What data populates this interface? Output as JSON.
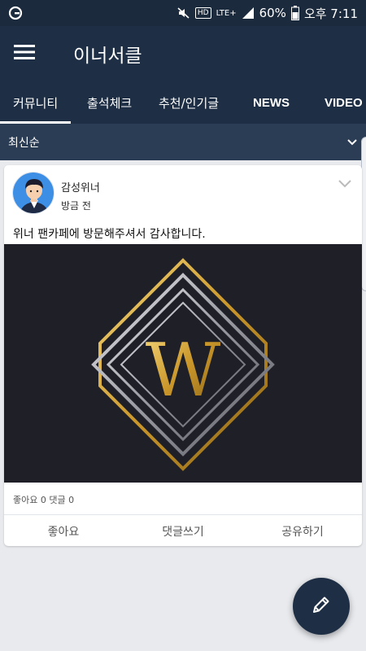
{
  "status_bar": {
    "battery": "60%",
    "time": "오후 7:11",
    "hd_badge": "HD",
    "lte_badge": "LTE+",
    "icons": [
      "carrier-logo-icon",
      "mute-icon",
      "hd-icon",
      "lte-icon",
      "signal-icon",
      "battery-icon"
    ]
  },
  "app_bar": {
    "title": "이너서클",
    "menu_icon": "hamburger-menu-icon"
  },
  "tabs": [
    {
      "label": "커뮤니티",
      "active": true
    },
    {
      "label": "출석체크",
      "active": false
    },
    {
      "label": "추천/인기글",
      "active": false
    },
    {
      "label": "NEWS",
      "active": false
    },
    {
      "label": "VIDEO",
      "active": false
    }
  ],
  "sort": {
    "label": "최신순",
    "icon": "chevron-down-icon"
  },
  "post": {
    "author": "감성위너",
    "time": "방금 전",
    "text": "위너 팬카페에 방문해주셔서 감사합니다.",
    "image_letter": "W",
    "stats": "좋아요 0 댓글 0",
    "actions": {
      "like": "좋아요",
      "comment": "댓글쓰기",
      "share": "공유하기"
    }
  },
  "fab": {
    "icon": "pencil-icon"
  },
  "colors": {
    "navy": "#1e2f45",
    "sort_bar": "#2b3d55",
    "gold": "#d4a62a",
    "background": "#e8eaee"
  }
}
